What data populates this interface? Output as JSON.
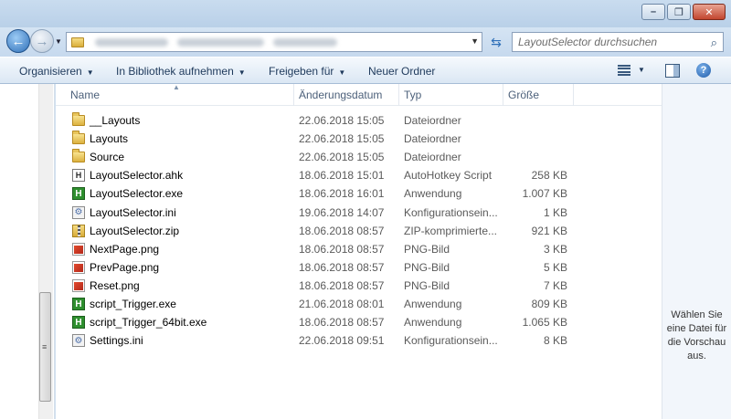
{
  "window": {
    "minimize_symbol": "–",
    "maximize_symbol": "❐",
    "close_symbol": "✕"
  },
  "address": {
    "back_icon": "←",
    "forward_icon": "→",
    "refresh_icon": "⇆",
    "search_placeholder": "LayoutSelector durchsuchen",
    "search_icon": "⌕"
  },
  "toolbar": {
    "organize": "Organisieren",
    "include_library": "In Bibliothek aufnehmen",
    "share": "Freigeben für",
    "new_folder": "Neuer Ordner",
    "help": "?"
  },
  "columns": {
    "name": "Name",
    "date": "Änderungsdatum",
    "type": "Typ",
    "size": "Größe"
  },
  "files": [
    {
      "name": "__Layouts",
      "date": "22.06.2018 15:05",
      "type": "Dateiordner",
      "size": "",
      "icon": "folder"
    },
    {
      "name": "Layouts",
      "date": "22.06.2018 15:05",
      "type": "Dateiordner",
      "size": "",
      "icon": "folder"
    },
    {
      "name": "Source",
      "date": "22.06.2018 15:05",
      "type": "Dateiordner",
      "size": "",
      "icon": "folder"
    },
    {
      "name": "LayoutSelector.ahk",
      "date": "18.06.2018 15:01",
      "type": "AutoHotkey Script",
      "size": "258 KB",
      "icon": "ahk"
    },
    {
      "name": "LayoutSelector.exe",
      "date": "18.06.2018 16:01",
      "type": "Anwendung",
      "size": "1.007 KB",
      "icon": "exe"
    },
    {
      "name": "LayoutSelector.ini",
      "date": "19.06.2018 14:07",
      "type": "Konfigurationsein...",
      "size": "1 KB",
      "icon": "ini"
    },
    {
      "name": "LayoutSelector.zip",
      "date": "18.06.2018 08:57",
      "type": "ZIP-komprimierte...",
      "size": "921 KB",
      "icon": "zip"
    },
    {
      "name": "NextPage.png",
      "date": "18.06.2018 08:57",
      "type": "PNG-Bild",
      "size": "3 KB",
      "icon": "png"
    },
    {
      "name": "PrevPage.png",
      "date": "18.06.2018 08:57",
      "type": "PNG-Bild",
      "size": "5 KB",
      "icon": "png"
    },
    {
      "name": "Reset.png",
      "date": "18.06.2018 08:57",
      "type": "PNG-Bild",
      "size": "7 KB",
      "icon": "png"
    },
    {
      "name": "script_Trigger.exe",
      "date": "21.06.2018 08:01",
      "type": "Anwendung",
      "size": "809 KB",
      "icon": "exe"
    },
    {
      "name": "script_Trigger_64bit.exe",
      "date": "18.06.2018 08:57",
      "type": "Anwendung",
      "size": "1.065 KB",
      "icon": "exe"
    },
    {
      "name": "Settings.ini",
      "date": "22.06.2018 09:51",
      "type": "Konfigurationsein...",
      "size": "8 KB",
      "icon": "ini"
    }
  ],
  "preview": {
    "message": "Wählen Sie eine Datei für die Vorschau aus."
  }
}
